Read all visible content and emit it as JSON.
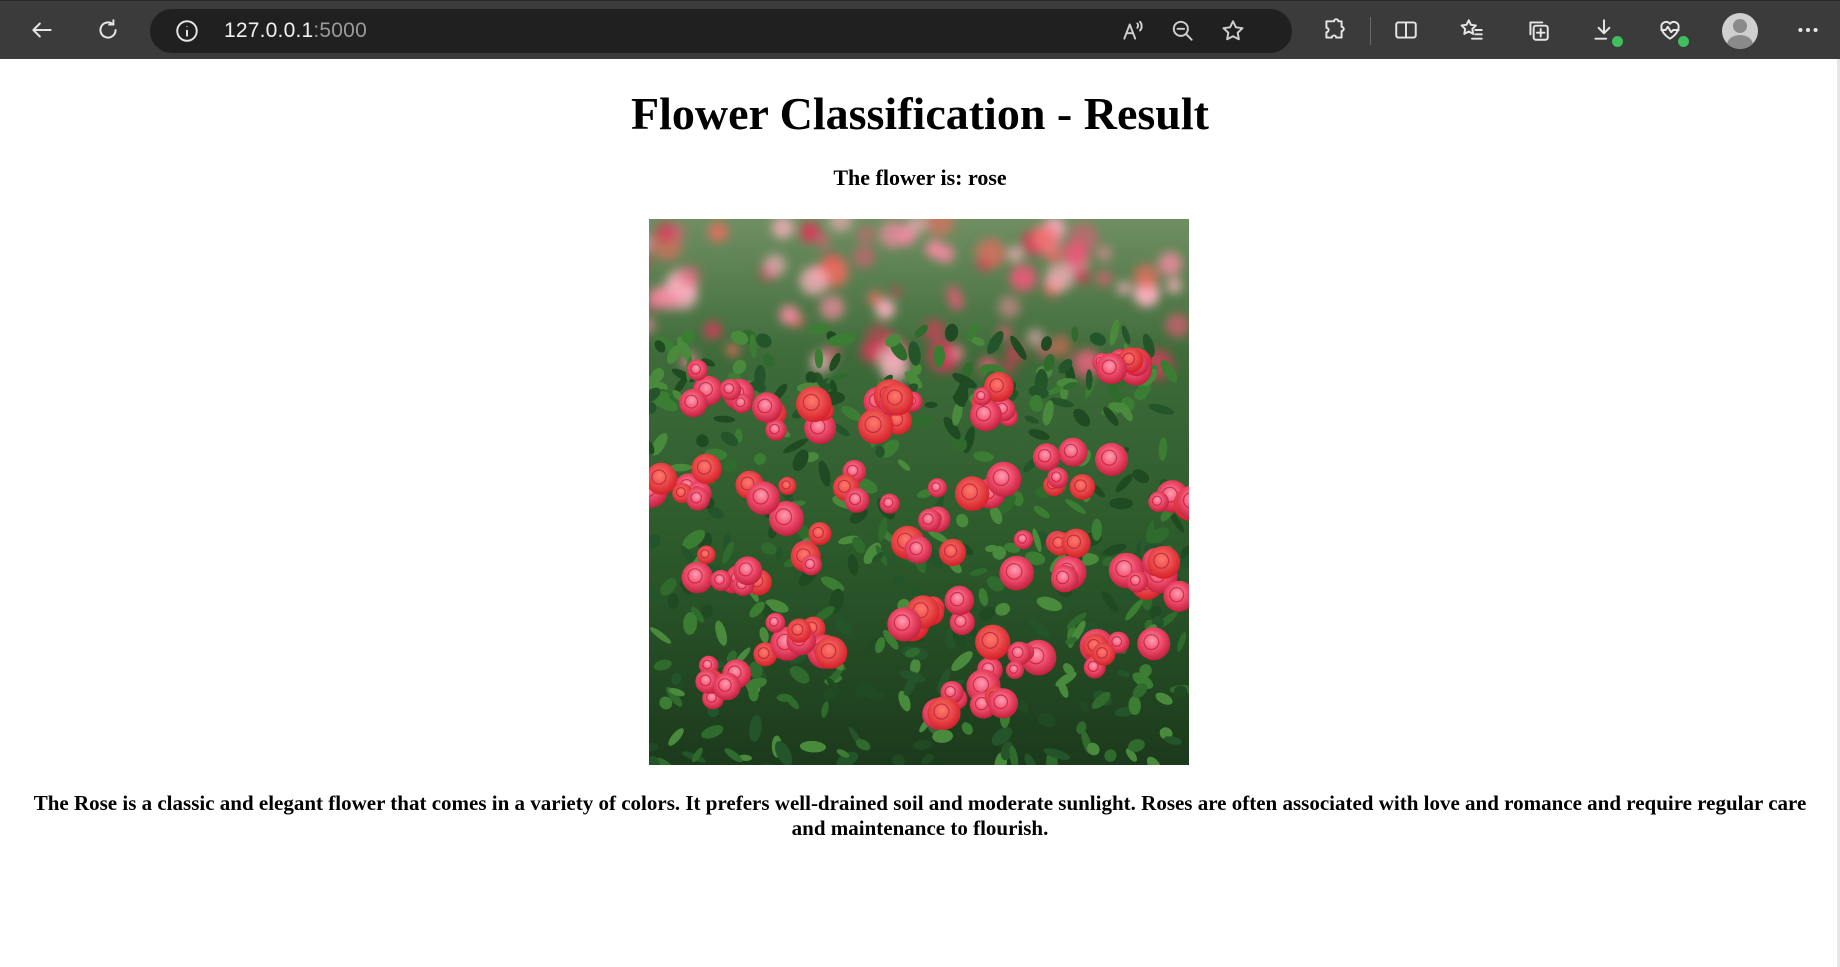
{
  "browser": {
    "url_host": "127.0.0.1",
    "url_port": ":5000",
    "icons": {
      "back": "back-arrow-icon",
      "refresh": "refresh-icon",
      "info": "info-icon",
      "read_aloud": "read-aloud-icon",
      "zoom_out": "zoom-out-icon",
      "favorite": "star-icon",
      "extensions": "puzzle-icon",
      "split_screen": "split-screen-icon",
      "favorites": "favorites-list-icon",
      "collections": "collections-icon",
      "downloads": "download-icon",
      "performance": "heart-pulse-icon",
      "profile": "profile-avatar-icon",
      "more": "more-dots-icon"
    },
    "accent": "#3fbf5e"
  },
  "page": {
    "title": "Flower Classification - Result",
    "result_text": "The flower is: rose",
    "image_subject": "rose-garden-photo",
    "description": "The Rose is a classic and elegant flower that comes in a variety of colors. It prefers well-drained soil and moderate sunlight. Roses are often associated with love and romance and require regular care and maintenance to flourish."
  }
}
